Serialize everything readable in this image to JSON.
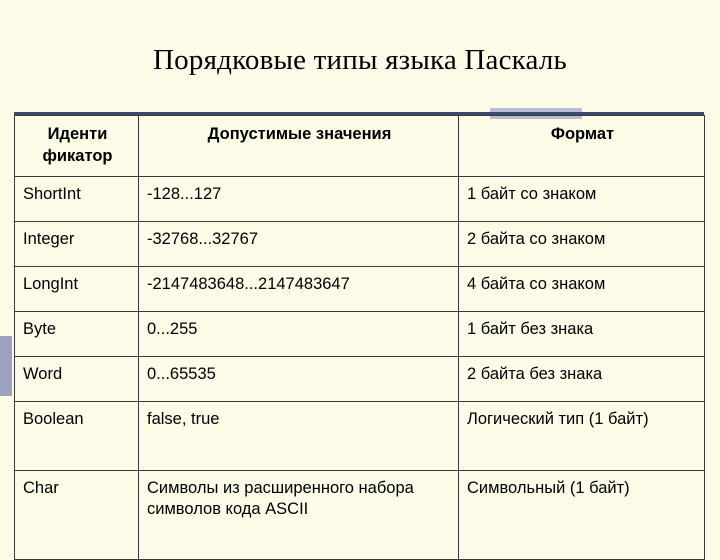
{
  "slide": {
    "title": "Порядковые типы языка Паскаль",
    "colors": {
      "background": "#fbfbe7",
      "accent_bar": "#b9bed6",
      "accent_left": "#9aa2bf",
      "rule": "#3a4a6b",
      "text": "#000000"
    },
    "table": {
      "headers": [
        "Иденти фикатор",
        "Допустимые значения",
        "Формат"
      ],
      "header_ident_line1": "Иденти",
      "header_ident_line2": "фикатор",
      "rows": [
        {
          "identifier": "ShortInt",
          "values": "-128...127",
          "format": "1 байт со знаком"
        },
        {
          "identifier": "Integer",
          "values": "-32768...32767",
          "format": "2 байта со знаком"
        },
        {
          "identifier": "LongInt",
          "values": "-2147483648...2147483647",
          "format": "4 байта со знаком"
        },
        {
          "identifier": "Byte",
          "values": "0...255",
          "format": "1 байт без знака"
        },
        {
          "identifier": "Word",
          "values": "0...65535",
          "format": "2 байта без знака"
        },
        {
          "identifier": "Boolean",
          "values": "false, true",
          "format": "Логический тип (1 байт)"
        },
        {
          "identifier": "Char",
          "values": "Символы из расширенного набора символов кода ASCII",
          "format": "Символьный (1 байт)"
        }
      ]
    }
  }
}
